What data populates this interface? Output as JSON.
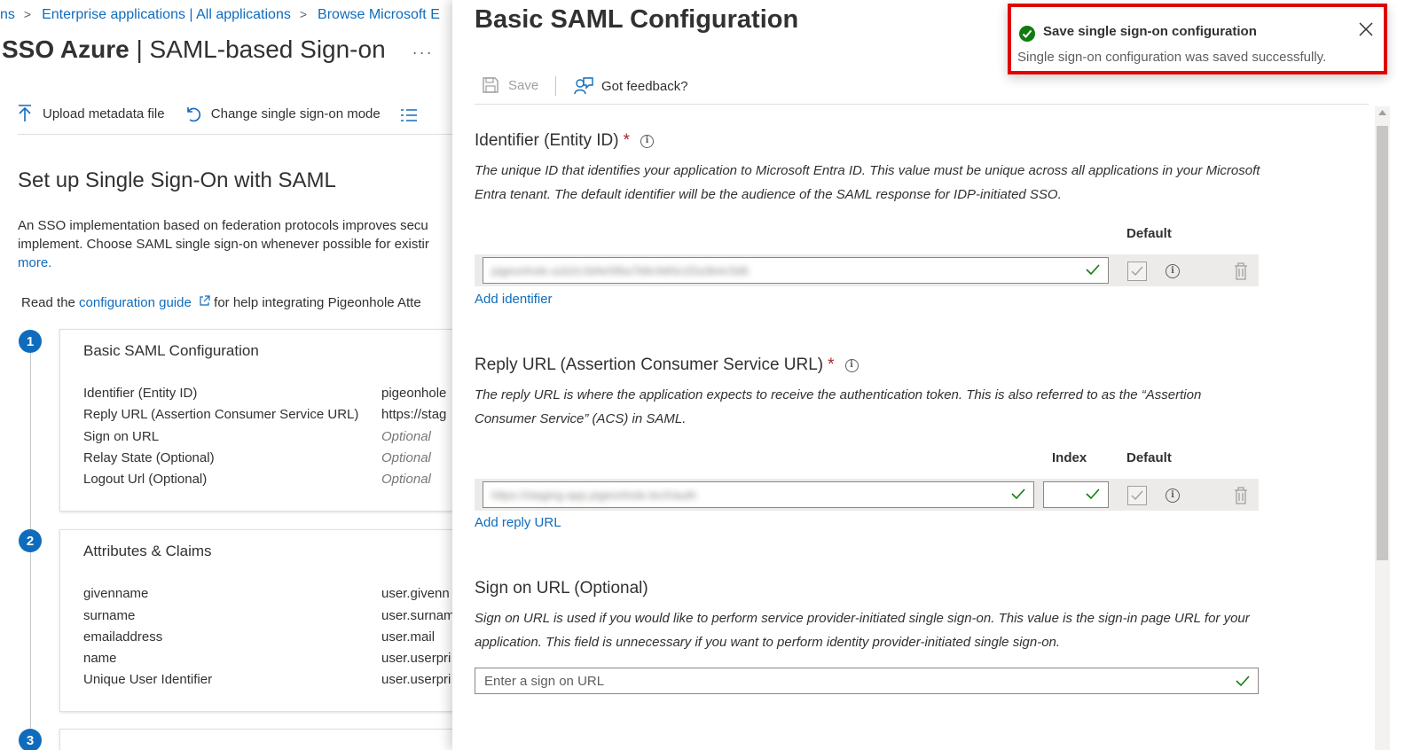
{
  "breadcrumb": {
    "items": [
      "ns",
      "Enterprise applications | All applications",
      "Browse Microsoft E"
    ]
  },
  "app": {
    "title_bold": "SSO Azure",
    "title_rest": " | SAML-based Sign-on",
    "more_label": "···"
  },
  "commandbar": {
    "upload_label": "Upload metadata file",
    "change_mode_label": "Change single sign-on mode"
  },
  "setup": {
    "heading": "Set up Single Sign-On with SAML",
    "desc_line1": "An SSO implementation based on federation protocols improves secu",
    "desc_line2": "implement. Choose SAML single sign-on whenever possible for existir",
    "learn_more": "more.",
    "read_prefix": "Read the ",
    "config_guide_link": "configuration guide",
    "read_suffix": " for help integrating Pigeonhole Atte"
  },
  "steps": [
    {
      "number": "1",
      "title": "Basic SAML Configuration",
      "rows": [
        {
          "key": "Identifier (Entity ID)",
          "value": "pigeonhole"
        },
        {
          "key": "Reply URL (Assertion Consumer Service URL)",
          "value": "https://stag"
        },
        {
          "key": "Sign on URL",
          "value": "Optional"
        },
        {
          "key": "Relay State (Optional)",
          "value": "Optional"
        },
        {
          "key": "Logout Url (Optional)",
          "value": "Optional"
        }
      ]
    },
    {
      "number": "2",
      "title": "Attributes & Claims",
      "rows": [
        {
          "key": "givenname",
          "value": "user.givenn"
        },
        {
          "key": "surname",
          "value": "user.surnam"
        },
        {
          "key": "emailaddress",
          "value": "user.mail"
        },
        {
          "key": "name",
          "value": "user.userpri"
        },
        {
          "key": "Unique User Identifier",
          "value": "user.userpri"
        }
      ]
    },
    {
      "number": "3"
    }
  ],
  "panel": {
    "title": "Basic SAML Configuration",
    "save_label": "Save",
    "feedback_label": "Got feedback?",
    "identifier": {
      "title": "Identifier (Entity ID)",
      "required_mark": "*",
      "description": "The unique ID that identifies your application to Microsoft Entra ID. This value must be unique across all applications in your Microsoft Entra tenant. The default identifier will be the audience of the SAML response for IDP-initiated SSO.",
      "col_default": "Default",
      "value_blurred": "pigeonhole-a1b2c3d4e5f6a7b8c9d0e1f2a3b4c5d6",
      "add_link": "Add identifier"
    },
    "reply": {
      "title": "Reply URL (Assertion Consumer Service URL)",
      "required_mark": "*",
      "description": "The reply URL is where the application expects to receive the authentication token. This is also referred to as the “Assertion Consumer Service” (ACS) in SAML.",
      "col_index": "Index",
      "col_default": "Default",
      "value_blurred": "https://staging-app.pigeonhole.tech/auth",
      "add_link": "Add reply URL"
    },
    "signon": {
      "title": "Sign on URL (Optional)",
      "description": "Sign on URL is used if you would like to perform service provider-initiated single sign-on. This value is the sign-in page URL for your application. This field is unnecessary if you want to perform identity provider-initiated single sign-on.",
      "placeholder": "Enter a sign on URL"
    }
  },
  "toast": {
    "title": "Save single sign-on configuration",
    "message": "Single sign-on configuration was saved successfully."
  },
  "colors": {
    "accent": "#0f6cbd",
    "success": "#107c10",
    "required": "#a4262c",
    "highlight_border": "#e00000"
  }
}
